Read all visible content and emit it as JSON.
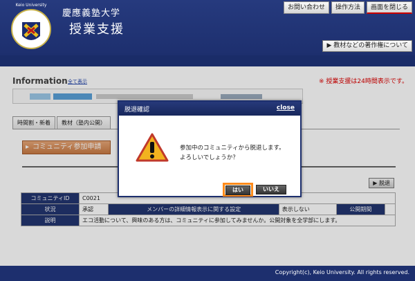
{
  "header": {
    "logo_text": "Keio University",
    "university": "慶應義塾大学",
    "system": "授業支援",
    "buttons": [
      "お問い合わせ",
      "操作方法",
      "画面を閉じる"
    ],
    "copyright_button": "▶ 教材などの著作権について"
  },
  "userbar": {
    "user": "",
    "datetime": ""
  },
  "information": {
    "title": "Information",
    "link": "全て表示",
    "notice": "※ 授業支援は24時間表示です。"
  },
  "tabs": [
    "時間割・新着",
    "教材（塾内公開）"
  ],
  "join_button": "コミュニティ参加申請",
  "leave_button": "▶ 脱退",
  "table": {
    "row1": {
      "label": "コミュニティID",
      "value": "C0021"
    },
    "row2": {
      "label": "状況",
      "status": "承認",
      "setting": "メンバーの詳細情報表示に関する設定",
      "display": "表示しない",
      "period_label": "公開期間"
    },
    "row3": {
      "label": "説明",
      "value": "エコ活動について、興味のある方は、コミュニティに参加してみませんか。公開対象を全学部にします。"
    }
  },
  "footer": "Copyright(c), Keio University.  All rights reserved.",
  "modal": {
    "title": "脱退確認",
    "close": "close",
    "message_line1": "参加中のコミュニティから脱退します。",
    "message_line2": "よろしいでしょうか？",
    "yes": "はい",
    "no": "いいえ"
  },
  "colors": {
    "navy": "#1d2f6e",
    "accent": "#ff8a1a",
    "join": "#c97a44",
    "notice": "#dd0000"
  }
}
